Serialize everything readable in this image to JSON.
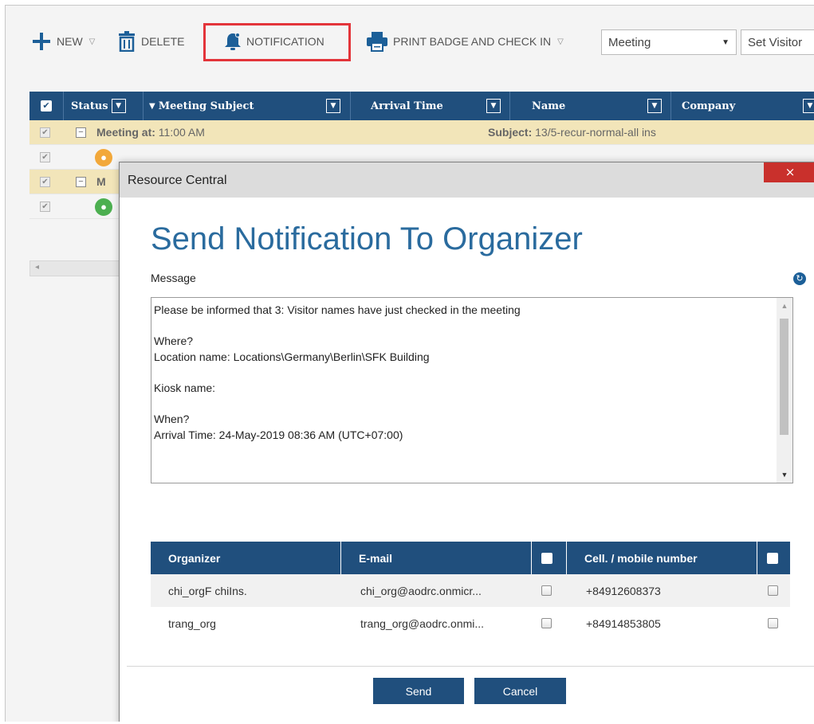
{
  "toolbar": {
    "new_label": "NEW",
    "delete_label": "DELETE",
    "notification_label": "NOTIFICATION",
    "print_label": "PRINT BADGE AND CHECK IN",
    "meeting_select_value": "Meeting",
    "visitor_select_value": "Set Visitor",
    "highlight_color": "#e3343a"
  },
  "grid": {
    "columns": [
      "Status",
      "Meeting Subject",
      "Arrival Time",
      "Name",
      "Company"
    ],
    "group_row": {
      "label": "Meeting at:",
      "time": "11:00 AM",
      "subject_label": "Subject:",
      "subject_value": "13/5-recur-normal-all ins"
    },
    "group_row_2_label_partial": "M"
  },
  "dialog": {
    "window_title": "Resource Central",
    "close_glyph": "×",
    "heading": "Send Notification To Organizer",
    "message_label": "Message",
    "message_text": "Please be informed that 3: Visitor names have just checked in the meeting\n\nWhere?\nLocation name: Locations\\Germany\\Berlin\\SFK Building\n\nKiosk name:\n\nWhen?\nArrival Time: 24-May-2019 08:36 AM (UTC+07:00)",
    "table": {
      "headers": {
        "organizer": "Organizer",
        "email": "E-mail",
        "phone": "Cell. / mobile number"
      },
      "rows": [
        {
          "organizer": "chi_orgF chiIns.",
          "email": "chi_org@aodrc.onmicr...",
          "phone": "+84912608373"
        },
        {
          "organizer": "trang_org",
          "email": "trang_org@aodrc.onmi...",
          "phone": "+84914853805"
        }
      ]
    },
    "send_label": "Send",
    "cancel_label": "Cancel",
    "brand_color": "#204f7d",
    "heading_color": "#2a6b9e"
  }
}
